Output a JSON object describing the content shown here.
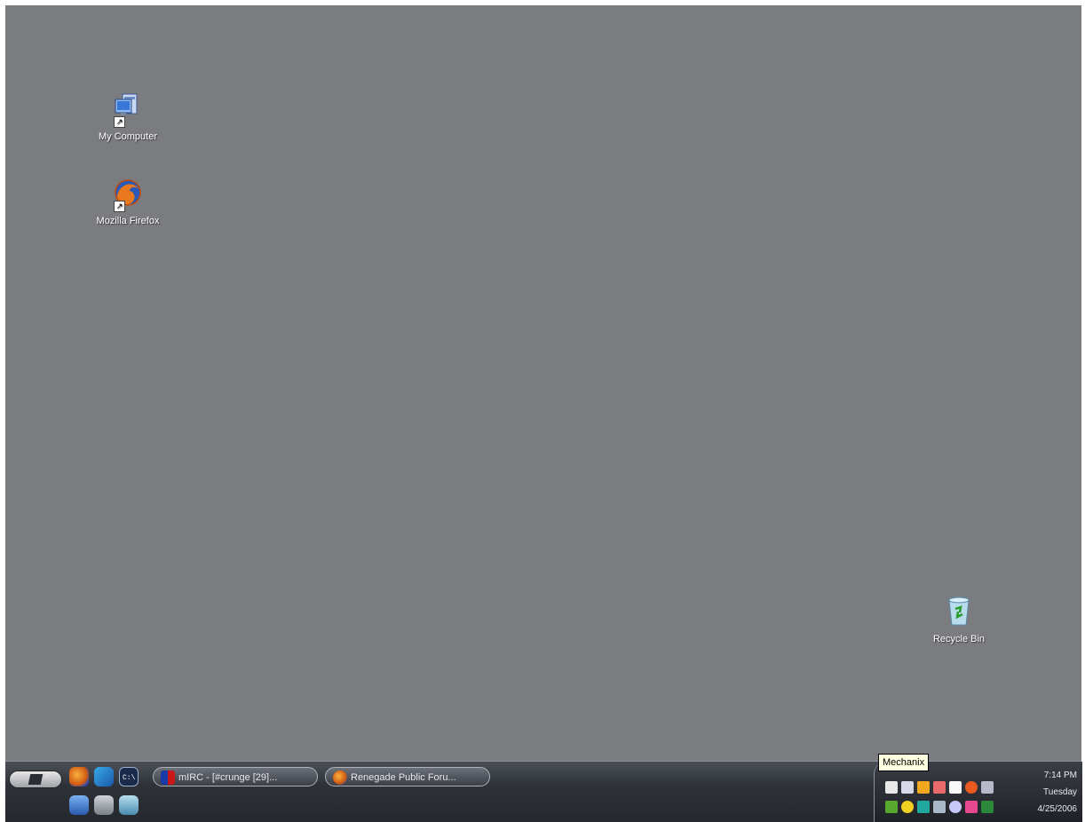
{
  "desktop": {
    "background_color": "#7b7c80",
    "icons": [
      {
        "label": "My Computer",
        "icon": "my-computer-icon"
      },
      {
        "label": "Mozilla Firefox",
        "icon": "firefox-icon"
      },
      {
        "label": "Recycle Bin",
        "icon": "recycle-bin-icon"
      }
    ]
  },
  "taskbar": {
    "start_icon": "windows-logo-icon",
    "quick_launch": [
      {
        "icon": "firefox-icon"
      },
      {
        "icon": "messenger-icon"
      },
      {
        "icon": "command-prompt-icon"
      },
      {
        "icon": "computer-icon"
      },
      {
        "icon": "show-desktop-icon"
      },
      {
        "icon": "recycle-icon"
      }
    ],
    "tasks": [
      {
        "label": "mIRC - [#crunge [29]...",
        "icon": "mirc-icon"
      },
      {
        "label": "Renegade Public Foru...",
        "icon": "firefox-icon"
      }
    ]
  },
  "tray": {
    "tooltip": "Mechanix",
    "clock": {
      "time": "7:14 PM",
      "day": "Tuesday",
      "date": "4/25/2006"
    }
  }
}
